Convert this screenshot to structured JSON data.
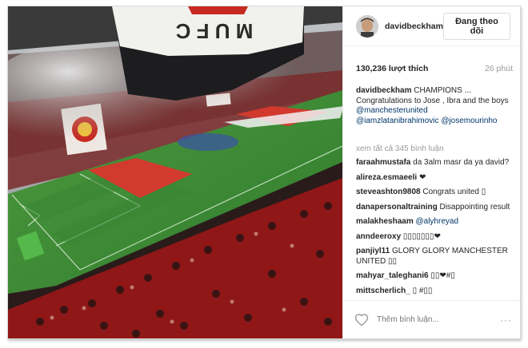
{
  "post": {
    "username": "davidbeckham",
    "follow_label": "Đang theo dõi",
    "likes": "130,236 lượt thích",
    "time": "26 phút",
    "caption_user": "davidbeckham",
    "caption_text": " CHAMPIONS ... Congratulations to Jose , Ibra and the boys ",
    "caption_mentions": [
      "@manchesterunited",
      "@iamzlatanibrahimovic",
      "@josemourinho"
    ],
    "caption_tail": "ᅟᅟ",
    "view_all": "xem tất cả 345 bình luận",
    "comments": [
      {
        "user": "faraahmustafa",
        "text": " da 3alm masr da ya david?"
      },
      {
        "user": "alireza.esmaeeli",
        "text": " ❤"
      },
      {
        "user": "steveashton9808",
        "text": " Congrats united ▯"
      },
      {
        "user": "danapersonaltraining",
        "text": " Disappointing result"
      },
      {
        "user": "malakheshaam",
        "text": "",
        "mention": "@alyhreyad"
      },
      {
        "user": "anndeeroxy",
        "text": " ▯▯▯▯▯▯▯❤"
      },
      {
        "user": "panjiyl11",
        "text": " GLORY GLORY MANCHESTER UNITED ▯▯"
      },
      {
        "user": "mahyar_taleghani6",
        "text": " ▯▯❤#▯"
      },
      {
        "user": "mittscherlich_",
        "text": " ▯ #▯▯"
      }
    ],
    "add_comment_placeholder": "Thêm bình luận...",
    "more_label": "···"
  },
  "photo": {
    "flag_text": "M U F C"
  },
  "icons": {
    "heart": "heart-outline-icon",
    "more": "more-options-icon"
  },
  "colors": {
    "link": "#003569",
    "muted": "#999999",
    "pitch": "#3f8a38",
    "crowd_red": "#a81d1d"
  }
}
